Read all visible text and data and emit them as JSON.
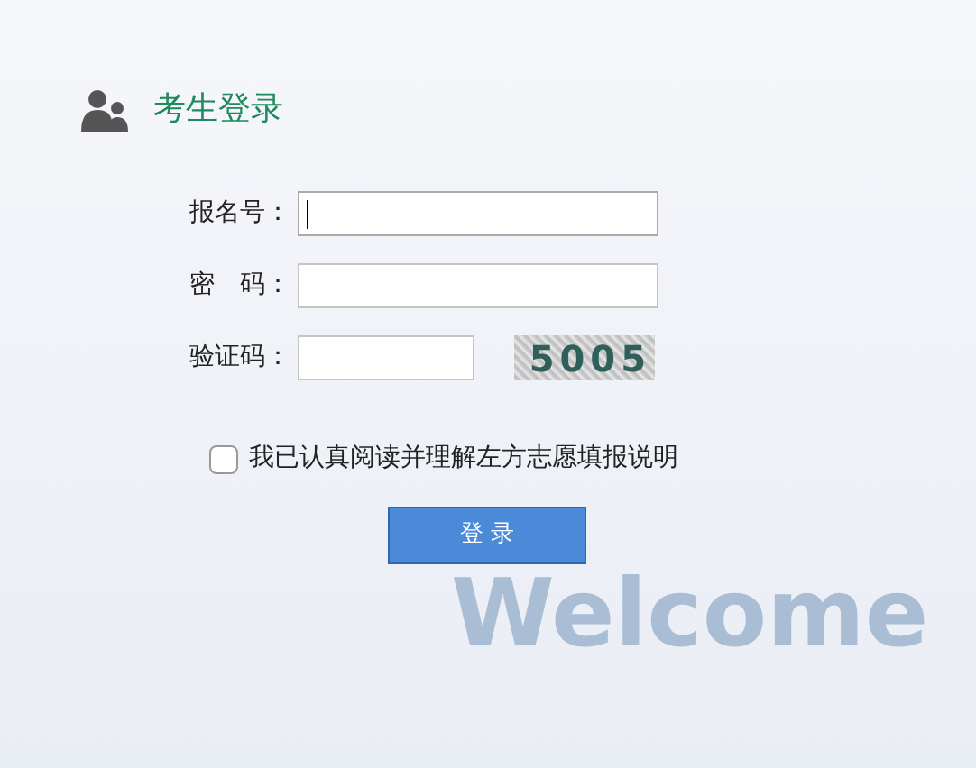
{
  "header": {
    "title": "考生登录"
  },
  "fields": [
    {
      "kind": "text",
      "label": "报名号：",
      "focused": true
    },
    {
      "kind": "password",
      "label": "密　码：",
      "focused": false
    },
    {
      "kind": "captcha",
      "label": "验证码：",
      "focused": false,
      "captcha": "5005"
    }
  ],
  "agreement": {
    "label": "我已认真阅读并理解左方志愿填报说明",
    "checked": false
  },
  "login_button": {
    "label": "登 录"
  },
  "background_text": "Welcome"
}
